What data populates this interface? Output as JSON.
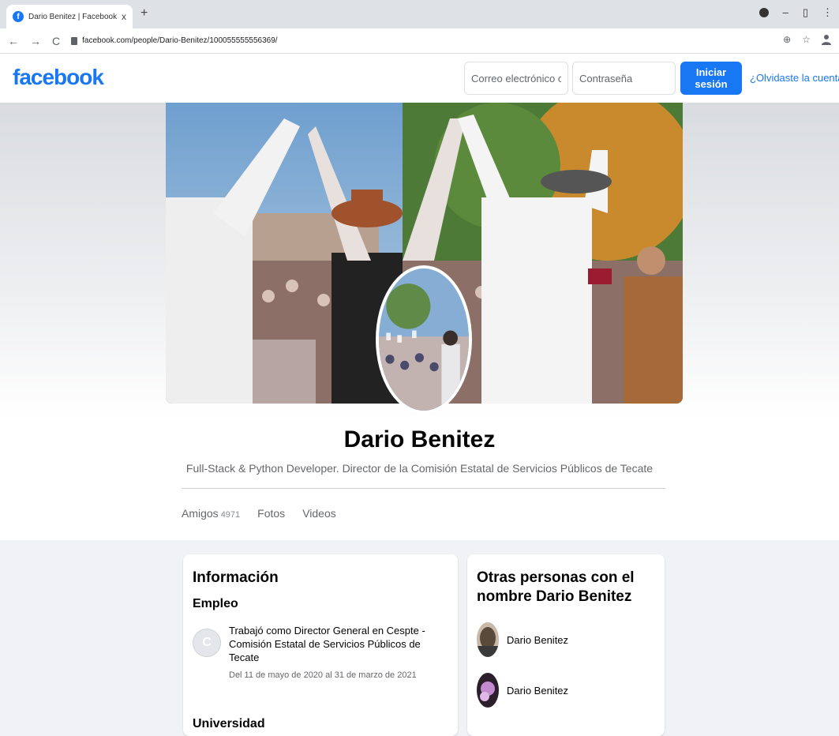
{
  "browser": {
    "tab_title": "Dario Benitez | Facebook",
    "tab_close": "x",
    "new_tab": "+",
    "url": "facebook.com/people/Dario-Benitez/100055555556369/",
    "back": "←",
    "forward": "→",
    "reload": "C",
    "minimize": "–",
    "maximize": "▯",
    "close": "⋮",
    "zoom_icon": "⊕",
    "star_icon": "☆",
    "profile_icon": "person"
  },
  "header": {
    "logo": "facebook",
    "email_placeholder": "Correo electrónico o teléfono",
    "password_placeholder": "Contraseña",
    "login_label": "Iniciar sesión",
    "forgot_label": "¿Olvidaste la cuenta?"
  },
  "profile": {
    "name": "Dario Benitez",
    "bio": "Full-Stack & Python Developer. Director de la Comisión Estatal de Servicios Públicos de Tecate",
    "tabs": [
      {
        "label": "Amigos",
        "count": "4971"
      },
      {
        "label": "Fotos"
      },
      {
        "label": "Videos"
      }
    ]
  },
  "info": {
    "title": "Información",
    "employment_title": "Empleo",
    "employment": {
      "initial": "C",
      "text": "Trabajó como Director General en Cespte - Comisión Estatal de Servicios Públicos de Tecate",
      "dates": "Del 11 de mayo de 2020 al 31 de marzo de 2021"
    },
    "university_title": "Universidad"
  },
  "others": {
    "title": "Otras personas con el nombre Dario Benitez",
    "people": [
      {
        "name": "Dario Benitez"
      },
      {
        "name": "Dario Benitez"
      }
    ]
  },
  "colors": {
    "brand": "#1877f2",
    "background": "#f0f2f5"
  }
}
